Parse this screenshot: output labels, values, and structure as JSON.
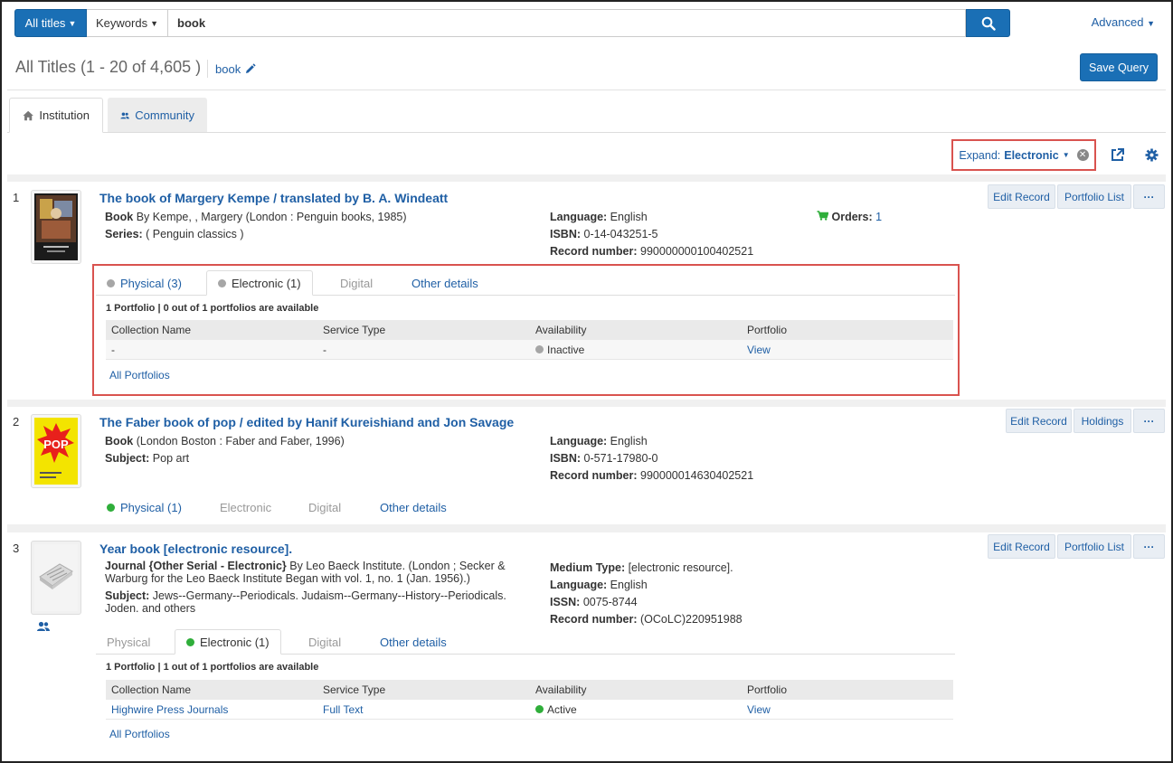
{
  "search": {
    "scope_label": "All titles",
    "field_label": "Keywords",
    "query": "book",
    "advanced_label": "Advanced"
  },
  "header": {
    "results_title": "All Titles (1 - 20 of 4,605 )",
    "query_chip": "book",
    "save_query_label": "Save Query"
  },
  "tabs": {
    "institution": "Institution",
    "community": "Community"
  },
  "toolbar": {
    "expand_prefix": "Expand:",
    "expand_value": "Electronic"
  },
  "results": [
    {
      "number": "1",
      "title": "The book of Margery Kempe / translated by B. A. Windeatt",
      "type": "Book",
      "byline": " By Kempe, , Margery (London : Penguin books, 1985)",
      "series_label": "Series:",
      "series_value": " ( Penguin classics )",
      "language_label": "Language:",
      "language": " English",
      "isbn_label": "ISBN:",
      "isbn": " 0-14-043251-5",
      "record_label": "Record number:",
      "record": " 990000000100402521",
      "orders_label": "Orders:",
      "orders": " 1",
      "buttons": [
        "Edit Record",
        "Portfolio List",
        "···"
      ],
      "subtabs": [
        "Physical (3)",
        "Electronic (1)",
        "Digital",
        "Other details"
      ],
      "summary": "1 Portfolio | 0 out of 1 portfolios are available",
      "table_headers": [
        "Collection Name",
        "Service Type",
        "Availability",
        "Portfolio"
      ],
      "row": [
        "-",
        "-",
        "Inactive",
        "View"
      ],
      "all_portfolios": "All Portfolios"
    },
    {
      "number": "2",
      "title": "The Faber book of pop / edited by Hanif Kureishiand and Jon Savage",
      "type": "Book",
      "byline": " (London Boston : Faber and Faber, 1996)",
      "subject_label": "Subject:",
      "subject": " Pop art",
      "language_label": "Language:",
      "language": " English",
      "isbn_label": "ISBN:",
      "isbn": " 0-571-17980-0",
      "record_label": "Record number:",
      "record": " 990000014630402521",
      "buttons": [
        "Edit Record",
        "Holdings",
        "···"
      ],
      "subtabs": [
        "Physical (1)",
        "Electronic",
        "Digital",
        "Other details"
      ]
    },
    {
      "number": "3",
      "title": "Year book [electronic resource].",
      "type": "Journal {Other Serial - Electronic}",
      "byline_1": " By Leo Baeck Institute. (London ; Secker &",
      "byline_2": "Warburg for the Leo Baeck Institute Began with vol. 1, no. 1 (Jan. 1956).)",
      "subject_label": "Subject:",
      "subject_1": " Jews--Germany--Periodicals. Judaism--Germany--History--Periodicals.",
      "subject_2": "Joden. and others",
      "medium_label": "Medium Type:",
      "medium": " [electronic resource].",
      "language_label": "Language:",
      "language": " English",
      "issn_label": "ISSN:",
      "issn": " 0075-8744",
      "record_label": "Record number:",
      "record": " (OCoLC)220951988",
      "buttons": [
        "Edit Record",
        "Portfolio List",
        "···"
      ],
      "subtabs": [
        "Physical",
        "Electronic (1)",
        "Digital",
        "Other details"
      ],
      "summary": "1 Portfolio | 1 out of 1 portfolios are available",
      "table_headers": [
        "Collection Name",
        "Service Type",
        "Availability",
        "Portfolio"
      ],
      "row": [
        "Highwire Press Journals",
        "Full Text",
        "Active",
        "View"
      ],
      "all_portfolios": "All Portfolios"
    }
  ],
  "colors": {
    "primary": "#1a6fb5",
    "link": "#1f5fa5",
    "highlight": "#d9534f",
    "active_dot": "#2fae3a",
    "inactive_dot": "#a6a6a6"
  }
}
